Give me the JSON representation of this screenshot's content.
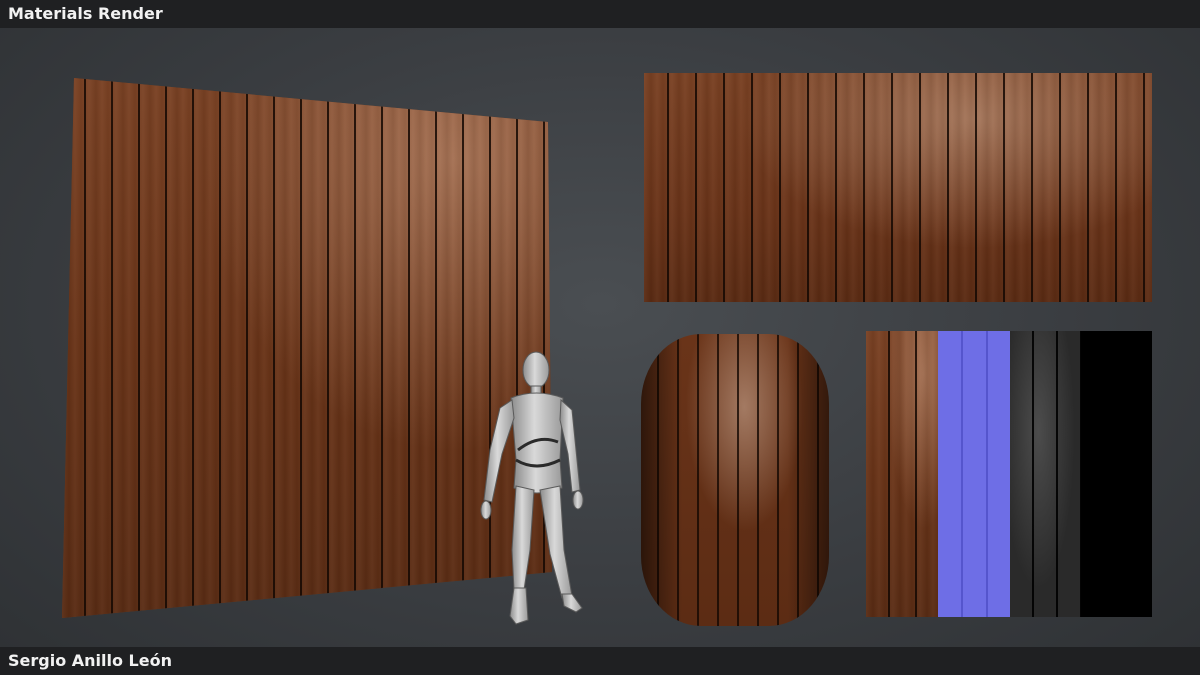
{
  "header": {
    "title": "Materials Render"
  },
  "footer": {
    "author": "Sergio Anillo León"
  },
  "colors": {
    "background": "#3a3d41",
    "bar": "#1f2022",
    "wood": "#6b3a1f",
    "normal_map": "#6e6ee6",
    "roughness_map": "#2a2a2a",
    "metallic_map": "#000000"
  },
  "icons": {
    "figure": "mannequin-figure"
  }
}
